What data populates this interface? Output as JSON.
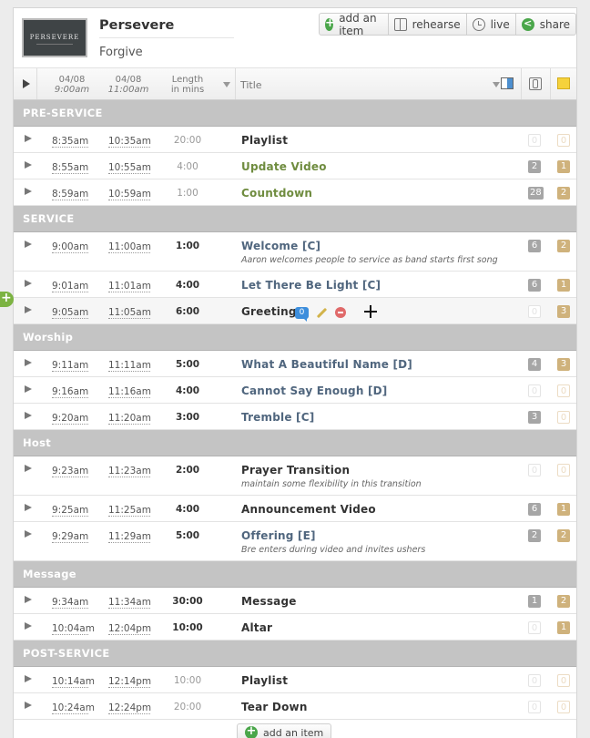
{
  "plan": {
    "thumbnail_text": "PERSEVERE",
    "title": "Persevere",
    "subtitle": "Forgive"
  },
  "toolbar": {
    "add_item": "add an item",
    "rehearse": "rehearse",
    "live": "live",
    "share": "share"
  },
  "columns": {
    "time1_date": "04/08",
    "time1_time": "9:00am",
    "time2_date": "04/08",
    "time2_time": "11:00am",
    "length_line1": "Length",
    "length_line2": "in mins",
    "title": "Title"
  },
  "sections": [
    {
      "name": "PRE-SERVICE",
      "rows": [
        {
          "t1": "8:35am",
          "t2": "10:35am",
          "len": "20:00",
          "len_style": "dim",
          "title": "Playlist",
          "title_style": "dark",
          "b1": "0",
          "b1_on": false,
          "b2": "0",
          "b2_on": false
        },
        {
          "t1": "8:55am",
          "t2": "10:55am",
          "len": "4:00",
          "len_style": "dim",
          "title": "Update Video",
          "title_style": "green",
          "b1": "2",
          "b1_on": true,
          "b2": "1",
          "b2_on": true
        },
        {
          "t1": "8:59am",
          "t2": "10:59am",
          "len": "1:00",
          "len_style": "dim",
          "title": "Countdown",
          "title_style": "green",
          "b1": "28",
          "b1_on": true,
          "b2": "2",
          "b2_on": true
        }
      ]
    },
    {
      "name": "SERVICE",
      "rows": [
        {
          "t1": "9:00am",
          "t2": "11:00am",
          "len": "1:00",
          "len_style": "bold",
          "title": "Welcome [C]",
          "title_style": "blue",
          "note": "Aaron welcomes people to service as band starts first song",
          "b1": "6",
          "b1_on": true,
          "b2": "2",
          "b2_on": true
        },
        {
          "t1": "9:01am",
          "t2": "11:01am",
          "len": "4:00",
          "len_style": "bold",
          "title": "Let There Be Light [C]",
          "title_style": "blue",
          "b1": "6",
          "b1_on": true,
          "b2": "1",
          "b2_on": true
        },
        {
          "t1": "9:05am",
          "t2": "11:05am",
          "len": "6:00",
          "len_style": "bold",
          "title": "Greeting",
          "title_style": "dark",
          "hover": true,
          "comment_count": "0",
          "b1": "0",
          "b1_on": false,
          "b2": "3",
          "b2_on": true
        }
      ]
    },
    {
      "name": "Worship",
      "rows": [
        {
          "t1": "9:11am",
          "t2": "11:11am",
          "len": "5:00",
          "len_style": "bold",
          "title": "What A Beautiful Name [D]",
          "title_style": "blue",
          "b1": "4",
          "b1_on": true,
          "b2": "3",
          "b2_on": true
        },
        {
          "t1": "9:16am",
          "t2": "11:16am",
          "len": "4:00",
          "len_style": "bold",
          "title": "Cannot Say Enough [D]",
          "title_style": "blue",
          "b1": "0",
          "b1_on": false,
          "b2": "0",
          "b2_on": false
        },
        {
          "t1": "9:20am",
          "t2": "11:20am",
          "len": "3:00",
          "len_style": "bold",
          "title": "Tremble [C]",
          "title_style": "blue",
          "b1": "3",
          "b1_on": true,
          "b2": "0",
          "b2_on": false
        }
      ]
    },
    {
      "name": "Host",
      "rows": [
        {
          "t1": "9:23am",
          "t2": "11:23am",
          "len": "2:00",
          "len_style": "bold",
          "title": "Prayer Transition",
          "title_style": "dark",
          "note": "maintain some flexibility in this transition",
          "b1": "0",
          "b1_on": false,
          "b2": "0",
          "b2_on": false
        },
        {
          "t1": "9:25am",
          "t2": "11:25am",
          "len": "4:00",
          "len_style": "bold",
          "title": "Announcement Video",
          "title_style": "dark",
          "b1": "6",
          "b1_on": true,
          "b2": "1",
          "b2_on": true
        },
        {
          "t1": "9:29am",
          "t2": "11:29am",
          "len": "5:00",
          "len_style": "bold",
          "title": "Offering [E]",
          "title_style": "blue",
          "note": "Bre enters during video and invites ushers",
          "b1": "2",
          "b1_on": true,
          "b2": "2",
          "b2_on": true
        }
      ]
    },
    {
      "name": "Message",
      "rows": [
        {
          "t1": "9:34am",
          "t2": "11:34am",
          "len": "30:00",
          "len_style": "bold",
          "title": "Message",
          "title_style": "dark",
          "b1": "1",
          "b1_on": true,
          "b2": "2",
          "b2_on": true
        },
        {
          "t1": "10:04am",
          "t2": "12:04pm",
          "len": "10:00",
          "len_style": "bold",
          "title": "Altar",
          "title_style": "dark",
          "b1": "0",
          "b1_on": false,
          "b2": "1",
          "b2_on": true
        }
      ]
    },
    {
      "name": "POST-SERVICE",
      "rows": [
        {
          "t1": "10:14am",
          "t2": "12:14pm",
          "len": "10:00",
          "len_style": "dim",
          "title": "Playlist",
          "title_style": "dark",
          "b1": "0",
          "b1_on": false,
          "b2": "0",
          "b2_on": false
        },
        {
          "t1": "10:24am",
          "t2": "12:24pm",
          "len": "20:00",
          "len_style": "dim",
          "title": "Tear Down",
          "title_style": "dark",
          "b1": "0",
          "b1_on": false,
          "b2": "0",
          "b2_on": false
        }
      ]
    }
  ],
  "footer": {
    "add_item": "add an item"
  },
  "colors": {
    "section_bg": "#c4c4c4",
    "title_blue": "#50667e",
    "title_green": "#6f8c3f",
    "badge_gray": "#a6a6a6",
    "badge_tan": "#cfb27c",
    "accent_green": "#4aa64a",
    "comment_blue": "#3d8edc"
  },
  "icons": {
    "add": "plus-circle-icon",
    "rehearse": "book-icon",
    "live": "clock-icon",
    "share": "share-icon",
    "attachments": "paperclip-icon",
    "notes": "note-icon"
  }
}
